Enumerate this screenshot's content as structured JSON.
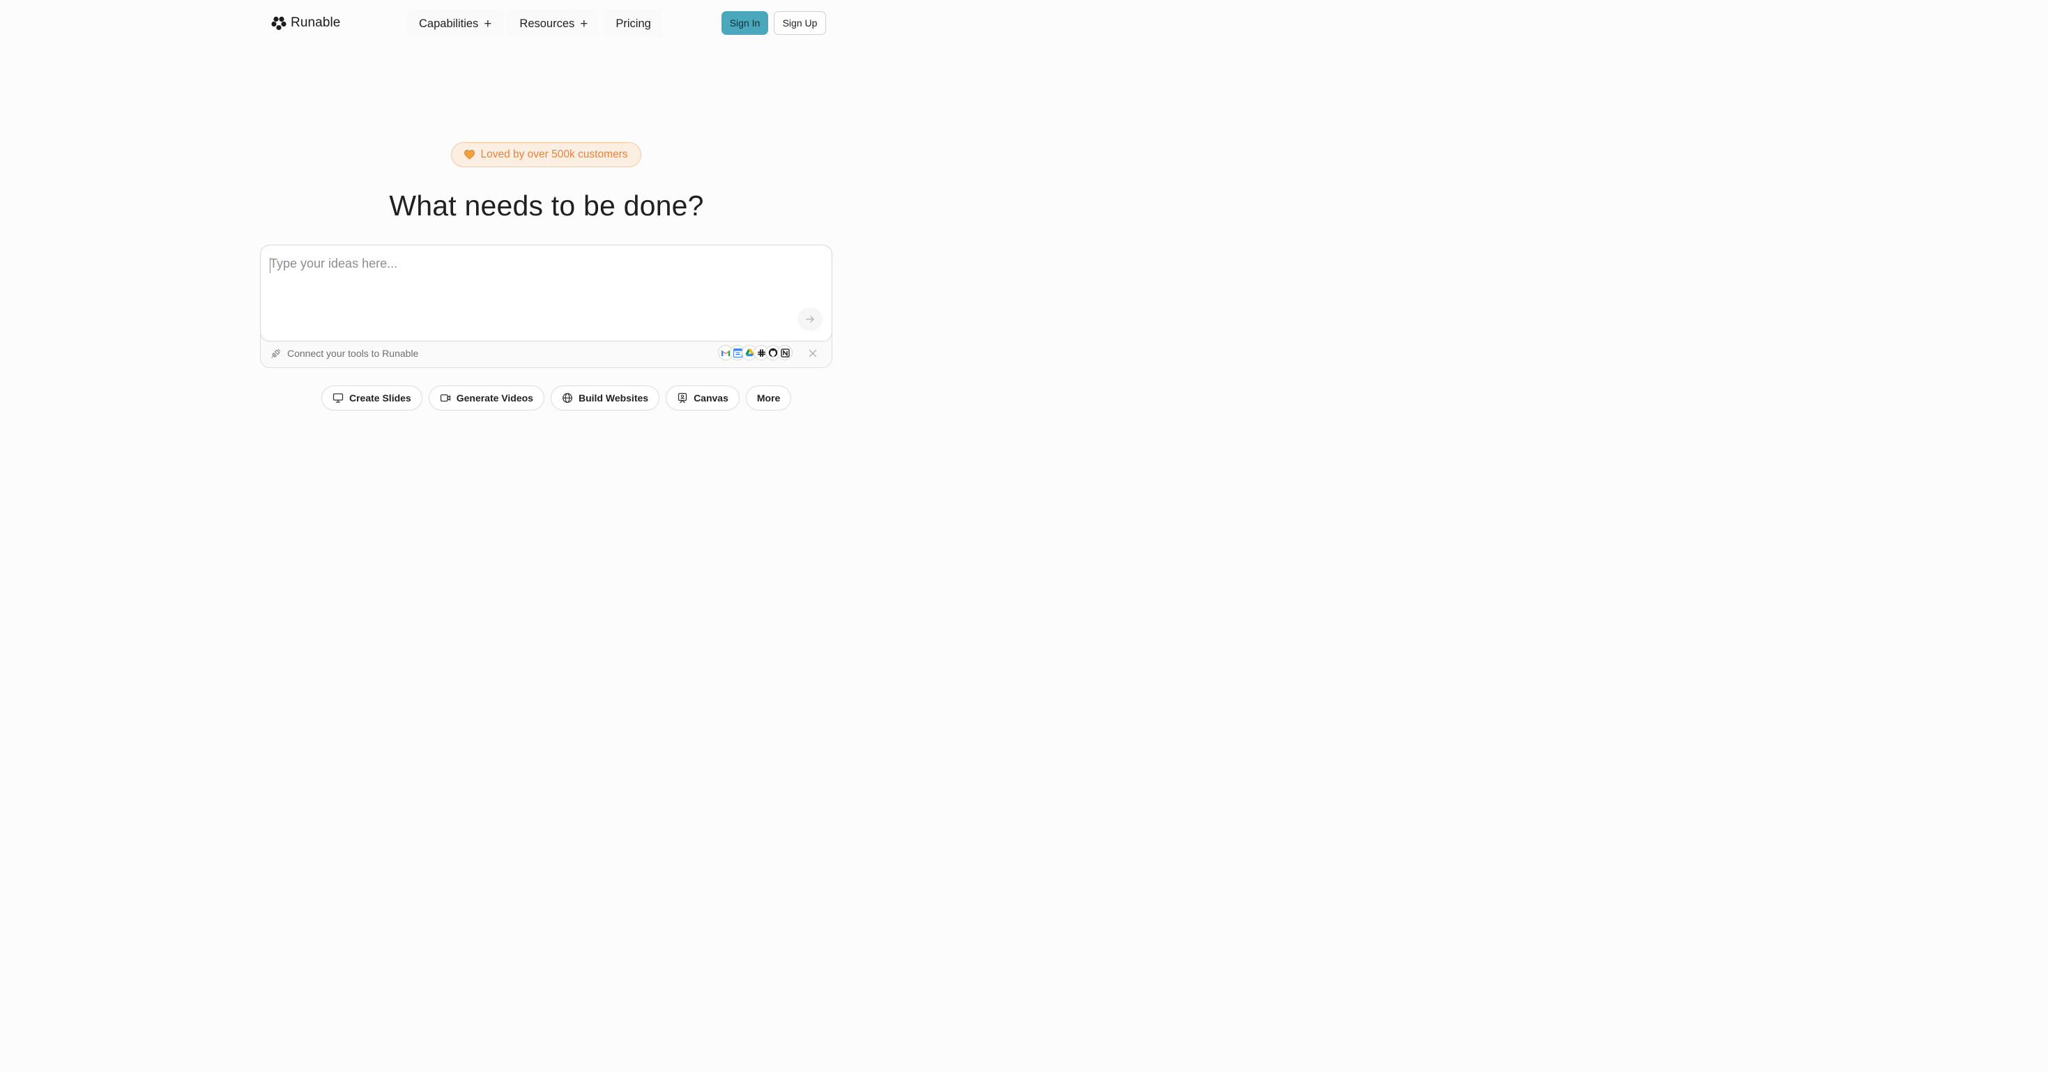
{
  "brand": {
    "name": "Runable"
  },
  "nav": {
    "items": [
      {
        "label": "Capabilities",
        "has_plus": true
      },
      {
        "label": "Resources",
        "has_plus": true
      },
      {
        "label": "Pricing",
        "has_plus": false
      }
    ],
    "plus_glyph": "+",
    "sign_in": "Sign In",
    "sign_up": "Sign Up"
  },
  "hero": {
    "badge": "Loved by over 500k customers",
    "headline": "What needs to be done?"
  },
  "composer": {
    "placeholder": "Type your ideas here...",
    "connect_text": "Connect your tools to Runable",
    "tools": [
      "gmail-icon",
      "google-calendar-icon",
      "google-drive-icon",
      "slack-icon",
      "github-icon",
      "notion-icon"
    ]
  },
  "chips": [
    {
      "label": "Create Slides",
      "icon": "presentation-icon"
    },
    {
      "label": "Generate Videos",
      "icon": "video-icon"
    },
    {
      "label": "Build Websites",
      "icon": "globe-icon"
    },
    {
      "label": "Canvas",
      "icon": "canvas-icon"
    },
    {
      "label": "More",
      "icon": ""
    }
  ],
  "colors": {
    "accent": "#4aa8bd",
    "badge_text": "#e4843f",
    "badge_bg": "#fdeee2",
    "background": "#fcfcfc"
  }
}
